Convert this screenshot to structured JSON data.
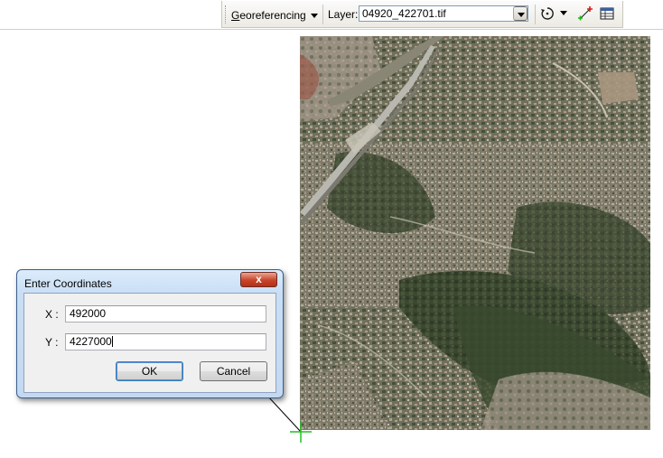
{
  "toolbar": {
    "georeferencing_menu": {
      "mnemonic": "G",
      "rest": "eoreferencing"
    },
    "layer_label": "Layer:",
    "layer_value": "04920_422701.tif",
    "icons": [
      "rotate-icon",
      "add-control-points-icon",
      "link-table-icon"
    ]
  },
  "map": {
    "description_icon": "aerial-orthophoto",
    "colors": {
      "vegetation": "#3d4a30",
      "urban": "#8a8676",
      "road": "#b9b8b0",
      "bare": "#a49886"
    }
  },
  "dialog": {
    "title": "Enter Coordinates",
    "close_glyph": "x",
    "x_label": "X :",
    "x_value": "492000",
    "y_label": "Y :",
    "y_value": "4227000",
    "ok_label": "OK",
    "cancel_label": "Cancel"
  },
  "colors": {
    "control_point_cross": "#1fc21f",
    "dialog_frame": "#c4d9f1",
    "close_button": "#c8442a"
  }
}
